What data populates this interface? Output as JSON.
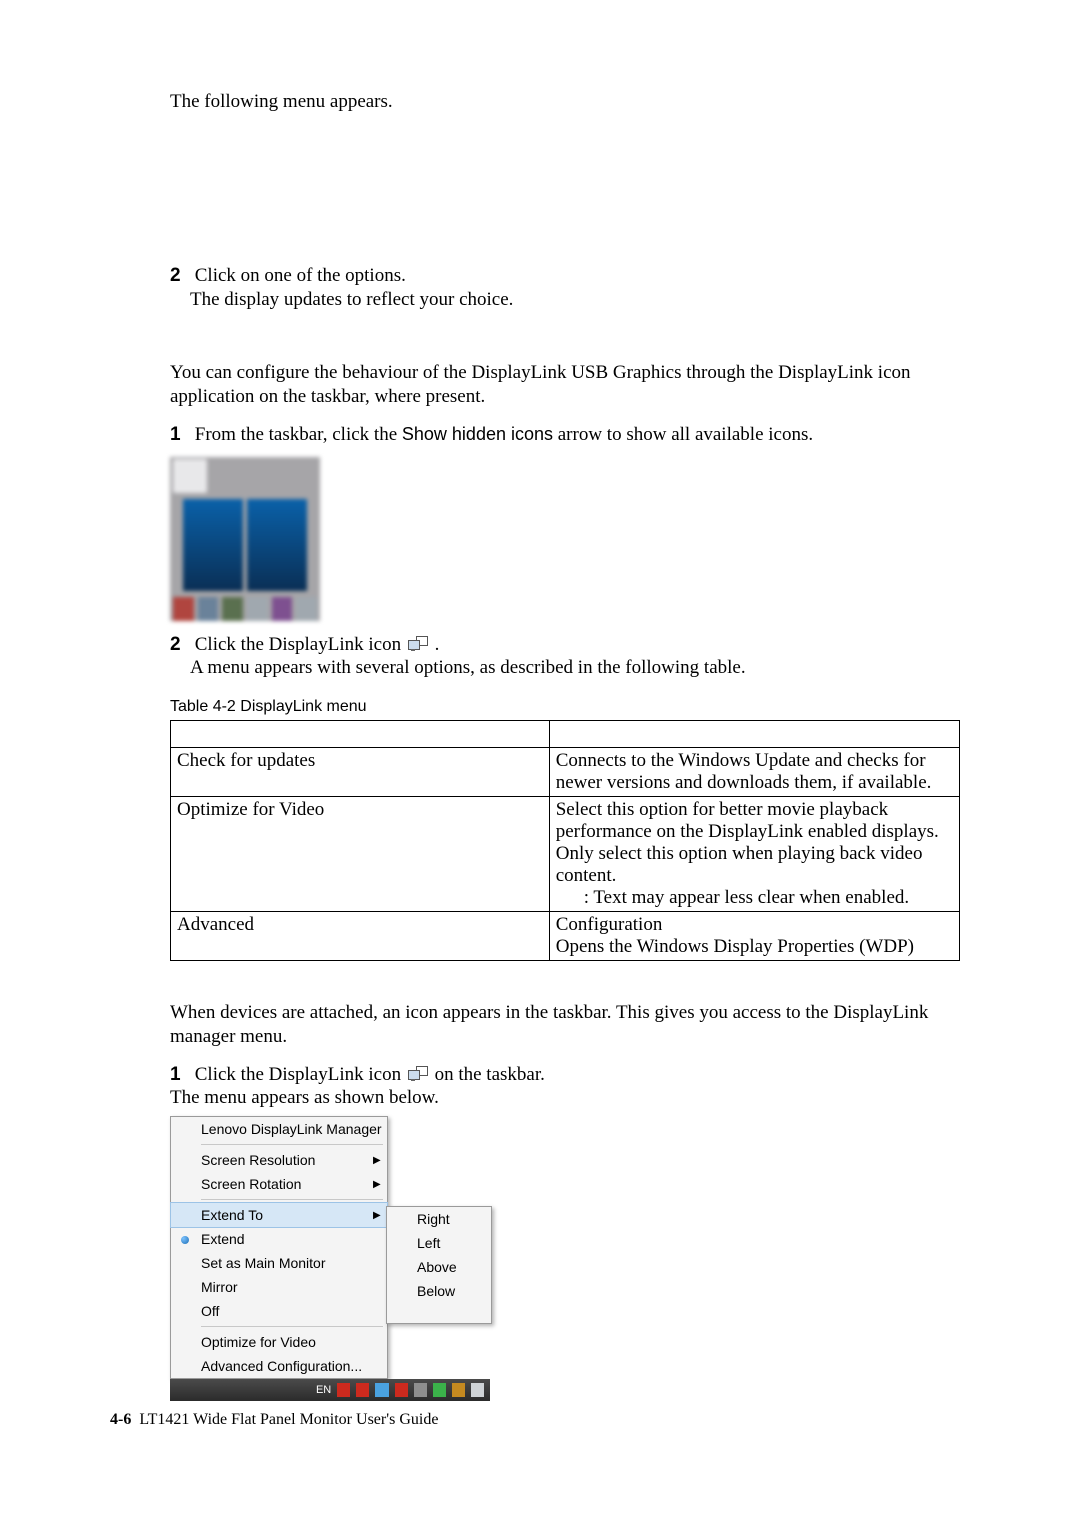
{
  "intro1": "The following menu appears.",
  "step2a": "2",
  "step2a_text": "Click on one of the options.",
  "step2a_sub": "The display updates to reflect your choice.",
  "para2": "You can configure the behaviour of the DisplayLink USB Graphics through the DisplayLink icon application on the taskbar, where present.",
  "step1b": "1",
  "step1b_text_a": "From the taskbar, click the ",
  "step1b_show": "Show hidden icons",
  "step1b_text_b": " arrow to show all available icons.",
  "step2c": "2",
  "step2c_text_a": "Click the DisplayLink icon ",
  "step2c_text_b": " .",
  "step2c_sub": "A menu appears with several options, as described in the following table.",
  "table_caption": "Table 4-2 DisplayLink menu",
  "table": {
    "r1c1": "Check for updates",
    "r1c2": "Connects to the Windows Update and checks for newer versions and downloads them, if available.",
    "r2c1": "Optimize for Video",
    "r2c2": "Select this option for better movie playback performance on the DisplayLink enabled displays. Only select this option when playing back video content.",
    "r2c2_note": ": Text may appear less clear when enabled.",
    "r3c1": "Advanced",
    "r3c2a": "Configuration",
    "r3c2b": "Opens the Windows Display Properties (WDP)"
  },
  "para3": "When devices are attached, an icon appears in the taskbar. This gives you access to the DisplayLink manager menu.",
  "step1d": "1",
  "step1d_text_a": "Click the DisplayLink icon ",
  "step1d_text_b": " on the taskbar.",
  "step1d_sub": "The menu appears as shown below.",
  "menu": {
    "title": "Lenovo DisplayLink Manager",
    "screen_res": "Screen Resolution",
    "screen_rot": "Screen Rotation",
    "extend_to": "Extend To",
    "extend": "Extend",
    "set_main": "Set as Main Monitor",
    "mirror": "Mirror",
    "off": "Off",
    "opt_video": "Optimize for Video",
    "adv_conf": "Advanced Configuration...",
    "sub_right": "Right",
    "sub_left": "Left",
    "sub_above": "Above",
    "sub_below": "Below"
  },
  "taskbar_en": "EN",
  "footer_num": "4-6",
  "footer_text": "LT1421 Wide Flat Panel Monitor User's Guide"
}
